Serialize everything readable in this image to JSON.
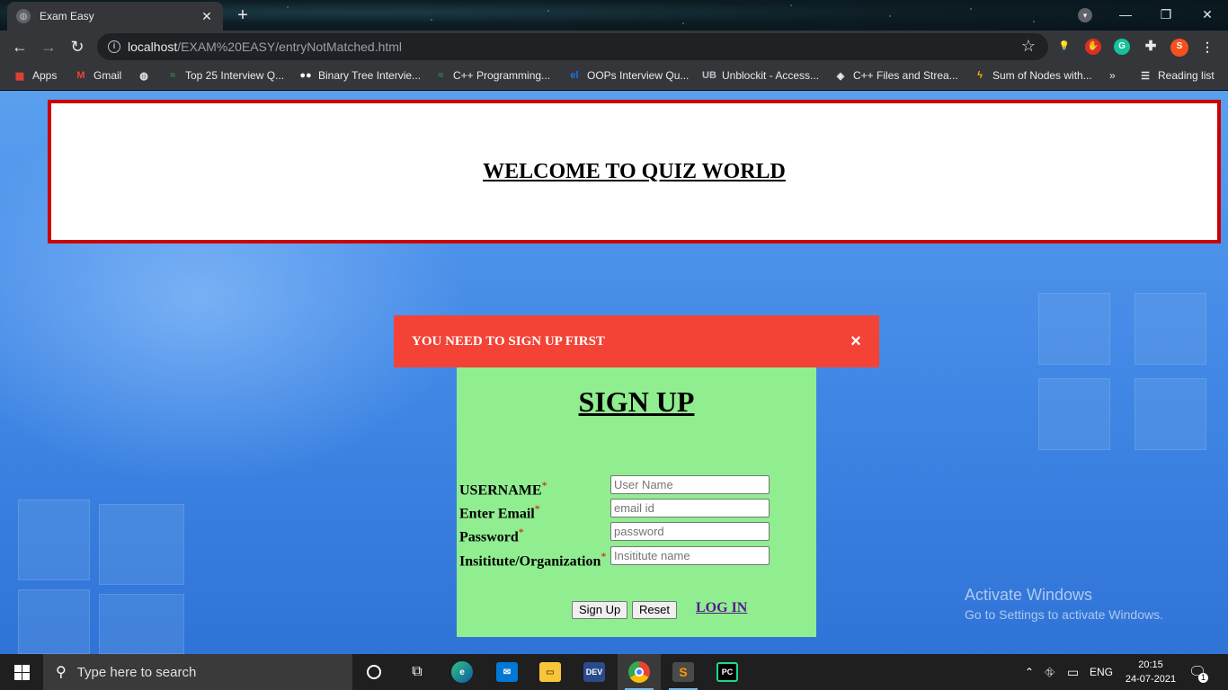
{
  "browser": {
    "tab": {
      "title": "Exam Easy",
      "close": "✕"
    },
    "new_tab": "+",
    "url": {
      "host": "localhost",
      "path": "/EXAM%20EASY/entryNotMatched.html"
    },
    "profile_initial": "S",
    "window_controls": {
      "minimize": "—",
      "restore": "❐",
      "close": "✕"
    },
    "bookmarks": [
      {
        "label": "Apps",
        "icon": "apps-grid-icon"
      },
      {
        "label": "Gmail",
        "icon": "gmail-icon"
      },
      {
        "label": "",
        "icon": "globe-icon"
      },
      {
        "label": "Top 25 Interview Q...",
        "icon": "gfg-icon"
      },
      {
        "label": "Binary Tree Intervie...",
        "icon": "medium-icon"
      },
      {
        "label": "C++ Programming...",
        "icon": "gfg-icon"
      },
      {
        "label": "OOPs Interview Qu...",
        "icon": "el-icon"
      },
      {
        "label": "Unblockit - Access...",
        "icon": "ub-icon"
      },
      {
        "label": "C++ Files and Strea...",
        "icon": "diamond-icon"
      },
      {
        "label": "Sum of Nodes with...",
        "icon": "flash-icon"
      }
    ],
    "bookmarks_more": "»",
    "reading_list": "Reading list"
  },
  "page": {
    "welcome_title": "WELCOME TO QUIZ WORLD",
    "alert": {
      "message": "YOU NEED TO SIGN UP FIRST",
      "close": "×"
    },
    "signup": {
      "title": "SIGN UP",
      "fields": [
        {
          "label": "USERNAME",
          "placeholder": "User Name",
          "value": ""
        },
        {
          "label": "Enter Email",
          "placeholder": "email id",
          "value": ""
        },
        {
          "label": "Password",
          "placeholder": "password",
          "value": ""
        },
        {
          "label": "Insititute/Organization",
          "placeholder": "Insititute name",
          "value": ""
        }
      ],
      "required_marker": "*",
      "signup_button": "Sign Up",
      "reset_button": "Reset",
      "login_link": "LOG IN"
    },
    "activation": {
      "title": "Activate Windows",
      "subtitle": "Go to Settings to activate Windows."
    }
  },
  "taskbar": {
    "search_placeholder": "Type here to search",
    "language": "ENG",
    "time": "20:15",
    "date": "24-07-2021",
    "notification_count": "1"
  }
}
